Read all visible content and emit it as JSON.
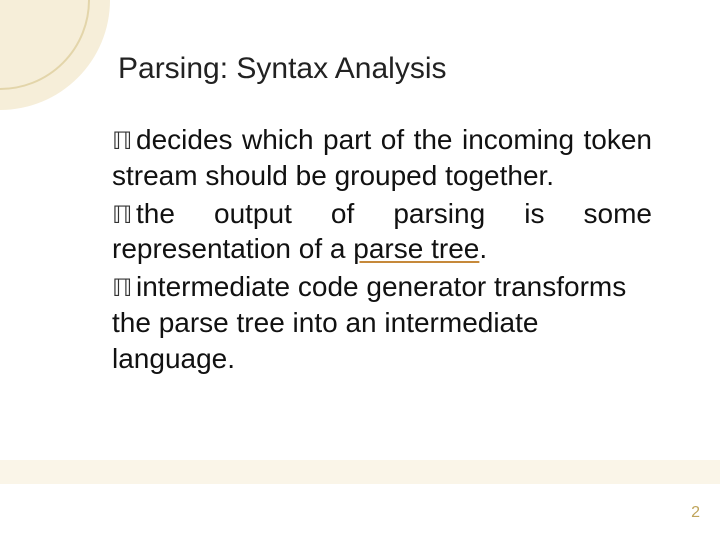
{
  "slide": {
    "title": "Parsing:  Syntax Analysis",
    "bullets": [
      {
        "lead": "decides",
        "rest": " which part of the incoming token stream should be grouped together."
      },
      {
        "lead": "the",
        "rest_before": " output of parsing is some representation of a ",
        "emph": "parse tree",
        "rest_after": "."
      },
      {
        "lead": "intermediate",
        "rest": " code generator transforms the parse tree into an intermediate language."
      }
    ],
    "page_number": "2",
    "bullet_glyph": "་∼"
  }
}
